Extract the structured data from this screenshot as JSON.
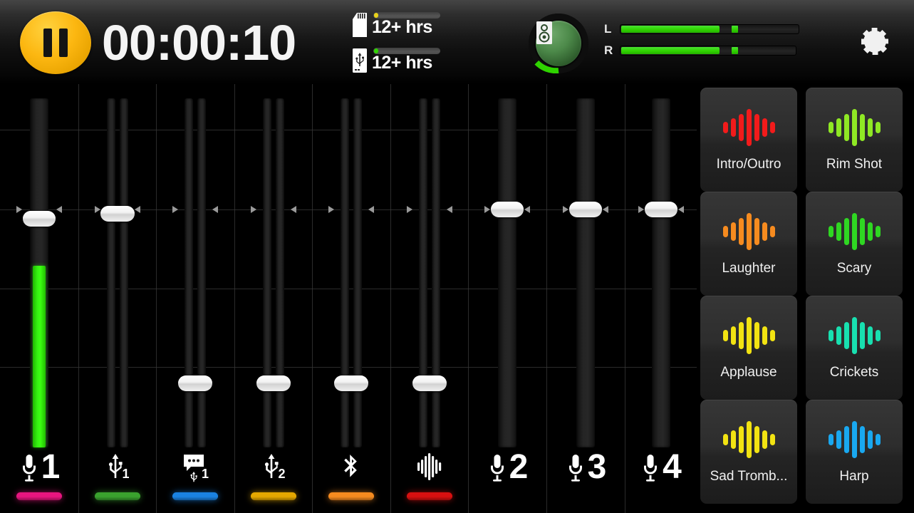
{
  "header": {
    "transport": {
      "state": "paused",
      "icon": "pause-icon",
      "color": "#fcb711"
    },
    "timecode": "00:00:10",
    "storage": [
      {
        "icon": "sd-card-icon",
        "label": "12+ hrs",
        "dot_color": "#e8d21a",
        "fill_pct": 4
      },
      {
        "icon": "usb-drive-icon",
        "label": "12+ hrs",
        "dot_color": "#2fd400",
        "fill_pct": 4
      }
    ],
    "monitor": {
      "icon": "speaker-icon",
      "arc_color": "#2fd400",
      "level_pct": 30
    },
    "output_meters": {
      "left": {
        "label": "L",
        "fill_pct": 55,
        "peak_pct": 62,
        "track_width": 252
      },
      "right": {
        "label": "R",
        "fill_pct": 55,
        "peak_pct": 62,
        "track_width": 248
      }
    },
    "settings": {
      "icon": "gear-icon",
      "label": "Settings"
    }
  },
  "mixer": {
    "unity_label": "unity-gain-marker",
    "channels": [
      {
        "id": "mic1",
        "icon": "microphone-icon",
        "number": "1",
        "sub": "",
        "color": "#e8157f",
        "stereo": false,
        "fader_pct": 50,
        "meter_pct": 52,
        "label": "Mic 1"
      },
      {
        "id": "usb1",
        "icon": "usb-icon",
        "number": "",
        "sub": "1",
        "color": "#3aa22e",
        "stereo": true,
        "fader_pct": 52,
        "meter_pct": 0,
        "label": "USB 1"
      },
      {
        "id": "chat",
        "icon": "chat-icon",
        "number": "",
        "sub": "1",
        "color": "#1a82e2",
        "stereo": true,
        "fader_pct": 0,
        "meter_pct": 0,
        "label": "Chat USB 1"
      },
      {
        "id": "usb2",
        "icon": "usb-icon",
        "number": "",
        "sub": "2",
        "color": "#e5a800",
        "stereo": true,
        "fader_pct": 0,
        "meter_pct": 0,
        "label": "USB 2"
      },
      {
        "id": "bluetooth",
        "icon": "bluetooth-icon",
        "number": "",
        "sub": "",
        "color": "#f68b1f",
        "stereo": true,
        "fader_pct": 0,
        "meter_pct": 0,
        "label": "Bluetooth"
      },
      {
        "id": "sfx",
        "icon": "waveform-icon",
        "number": "",
        "sub": "",
        "color": "#d81010",
        "stereo": true,
        "fader_pct": 0,
        "meter_pct": 0,
        "label": "Sound Effects"
      },
      {
        "id": "mic2",
        "icon": "microphone-icon",
        "number": "2",
        "sub": "",
        "color": "",
        "stereo": false,
        "fader_pct": 52,
        "meter_pct": 0,
        "label": "Mic 2"
      },
      {
        "id": "mic3",
        "icon": "microphone-icon",
        "number": "3",
        "sub": "",
        "color": "",
        "stereo": false,
        "fader_pct": 52,
        "meter_pct": 0,
        "label": "Mic 3"
      },
      {
        "id": "mic4",
        "icon": "microphone-icon",
        "number": "4",
        "sub": "",
        "color": "",
        "stereo": false,
        "fader_pct": 52,
        "meter_pct": 0,
        "label": "Mic 4"
      }
    ]
  },
  "soundboard": {
    "pads": [
      {
        "label": "Intro/Outro",
        "color": "#f21b1b",
        "icon": "waveform-icon"
      },
      {
        "label": "Rim Shot",
        "color": "#8fe824",
        "icon": "waveform-icon"
      },
      {
        "label": "Laughter",
        "color": "#f68b1f",
        "icon": "waveform-icon"
      },
      {
        "label": "Scary",
        "color": "#2fd722",
        "icon": "waveform-icon"
      },
      {
        "label": "Applause",
        "color": "#f2e312",
        "icon": "waveform-icon"
      },
      {
        "label": "Crickets",
        "color": "#18e0b0",
        "icon": "waveform-icon"
      },
      {
        "label": "Sad Tromb...",
        "color": "#f2e312",
        "icon": "waveform-icon"
      },
      {
        "label": "Harp",
        "color": "#19a8f0",
        "icon": "waveform-icon"
      }
    ]
  }
}
